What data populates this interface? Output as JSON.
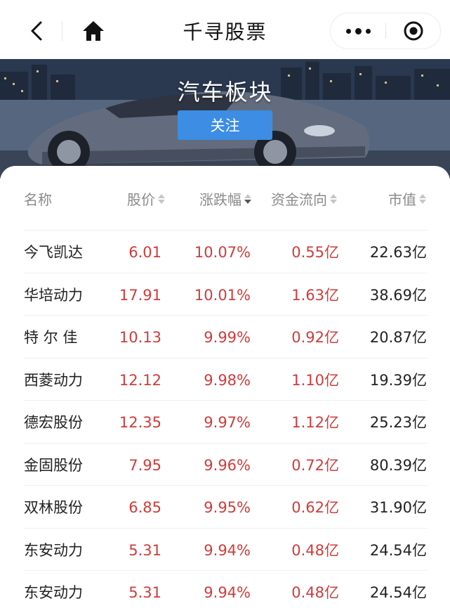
{
  "navbar": {
    "title": "千寻股票",
    "back_icon": "chevron-left-icon",
    "home_icon": "home-icon",
    "more_icon": "more-dots-icon",
    "close_icon": "target-close-icon"
  },
  "banner": {
    "title": "汽车板块",
    "follow_label": "关注"
  },
  "table": {
    "headers": {
      "name": "名称",
      "price": "股价",
      "change": "涨跌幅",
      "flow": "资金流向",
      "market_cap": "市值"
    },
    "active_sort": "change",
    "rows": [
      {
        "name": "今飞凯达",
        "price": "6.01",
        "change": "10.07%",
        "flow": "0.55亿",
        "market_cap": "22.63亿"
      },
      {
        "name": "华培动力",
        "price": "17.91",
        "change": "10.01%",
        "flow": "1.63亿",
        "market_cap": "38.69亿"
      },
      {
        "name": "特 尔 佳",
        "price": "10.13",
        "change": "9.99%",
        "flow": "0.92亿",
        "market_cap": "20.87亿"
      },
      {
        "name": "西菱动力",
        "price": "12.12",
        "change": "9.98%",
        "flow": "1.10亿",
        "market_cap": "19.39亿"
      },
      {
        "name": "德宏股份",
        "price": "12.35",
        "change": "9.97%",
        "flow": "1.12亿",
        "market_cap": "25.23亿"
      },
      {
        "name": "金固股份",
        "price": "7.95",
        "change": "9.96%",
        "flow": "0.72亿",
        "market_cap": "80.39亿"
      },
      {
        "name": "双林股份",
        "price": "6.85",
        "change": "9.95%",
        "flow": "0.62亿",
        "market_cap": "31.90亿"
      },
      {
        "name": "东安动力",
        "price": "5.31",
        "change": "9.94%",
        "flow": "0.48亿",
        "market_cap": "24.54亿"
      },
      {
        "name": "东安动力",
        "price": "5.31",
        "change": "9.94%",
        "flow": "0.48亿",
        "market_cap": "24.54亿"
      }
    ]
  },
  "colors": {
    "up_red": "#d13b3b",
    "follow_blue": "#3c8de3",
    "header_gray": "#8a8a8a"
  }
}
